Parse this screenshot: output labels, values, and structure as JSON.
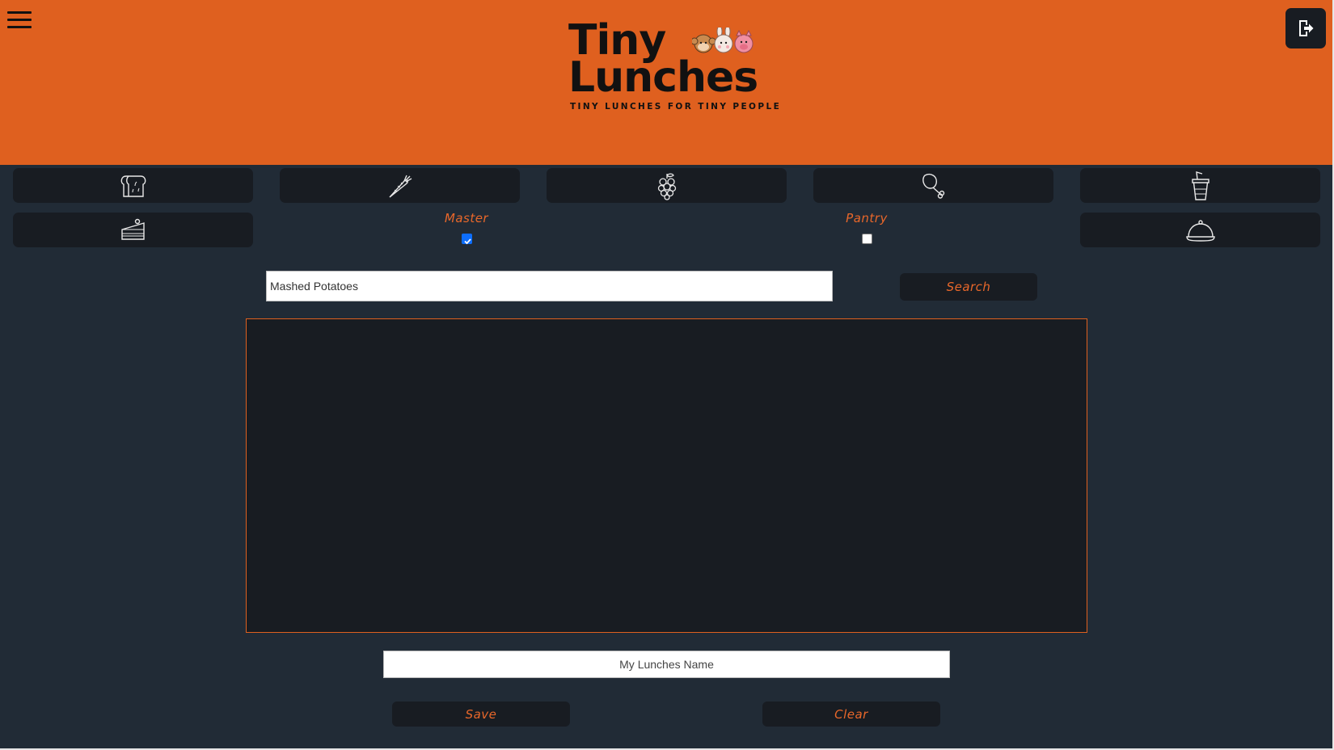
{
  "header": {
    "logo": {
      "line1": "Tiny",
      "line2": "Lunches",
      "tagline": "TINY LUNCHES FOR TINY PEOPLE"
    },
    "menu_icon": "hamburger-menu-icon",
    "logout_icon": "logout-icon"
  },
  "categories": [
    {
      "icon": "bread-icon"
    },
    {
      "icon": "carrot-icon"
    },
    {
      "icon": "grapes-icon"
    },
    {
      "icon": "drumstick-icon"
    },
    {
      "icon": "drink-cup-icon"
    },
    {
      "icon": "cake-slice-icon"
    },
    {
      "icon": "serving-cloche-icon"
    }
  ],
  "filters": {
    "master": {
      "label": "Master",
      "checked": true
    },
    "pantry": {
      "label": "Pantry",
      "checked": false
    }
  },
  "search": {
    "value": "Mashed Potatoes",
    "button_label": "Search"
  },
  "lunch": {
    "name_placeholder": "My Lunches Name",
    "save_label": "Save",
    "clear_label": "Clear"
  },
  "colors": {
    "header_bg": "#df601f",
    "page_bg": "#212b36",
    "button_bg": "#181c22",
    "accent_text": "#e8672a"
  }
}
